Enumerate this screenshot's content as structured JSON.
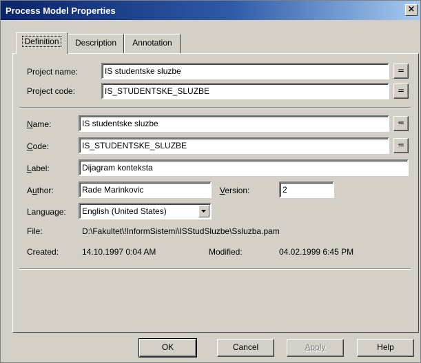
{
  "window": {
    "title": "Process Model Properties",
    "close_glyph": "×"
  },
  "tabs": [
    {
      "label": "Definition",
      "active": true
    },
    {
      "label": "Description",
      "active": false
    },
    {
      "label": "Annotation",
      "active": false
    }
  ],
  "definition": {
    "project_name": {
      "label": "Project name:",
      "value": "IS studentske sluzbe"
    },
    "project_code": {
      "label": "Project code:",
      "value": "IS_STUDENTSKE_SLUZBE"
    },
    "name": {
      "label": "Name:",
      "value": "IS studentske sluzbe"
    },
    "code": {
      "label": "Code:",
      "value": "IS_STUDENTSKE_SLUZBE"
    },
    "label": {
      "label": "Label:",
      "value": "Dijagram konteksta"
    },
    "author": {
      "label": "Author:",
      "value": "Rade Marinkovic"
    },
    "version": {
      "label": "Version:",
      "value": "2"
    },
    "language": {
      "label": "Language:",
      "value": "English (United States)"
    },
    "file": {
      "label": "File:",
      "value": "D:\\Fakultet\\!InformSistemi\\ISStudSluzbe\\Ssluzba.pam"
    },
    "created": {
      "label": "Created:",
      "value": "14.10.1997  0:04 AM"
    },
    "modified": {
      "label": "Modified:",
      "value": "04.02.1999  6:45 PM"
    },
    "eq_glyph": "="
  },
  "buttons": {
    "ok": "OK",
    "cancel": "Cancel",
    "apply": "Apply",
    "help": "Help"
  },
  "colors": {
    "titlebar_start": "#0a246a",
    "titlebar_end": "#a6caf0",
    "face": "#d4d0c8"
  }
}
